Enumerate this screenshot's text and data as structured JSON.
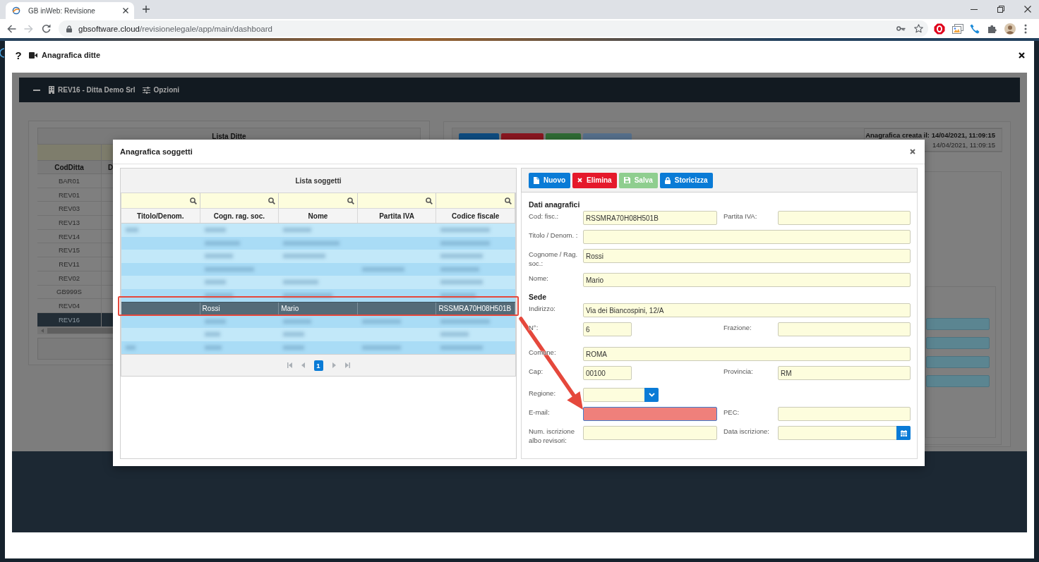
{
  "browser": {
    "tabs": [
      {
        "title": "GB inWeb: Revisione",
        "selected": true
      }
    ],
    "history": {
      "can_go_back": true,
      "can_go_forward": false
    },
    "address": {
      "host": "gbsoftware.cloud",
      "path": "/revisionelegale/app/main/dashboard"
    }
  },
  "window": {
    "help": "?",
    "title": "Anagrafica ditte"
  },
  "company_bar": {
    "title": "REV16 - Ditta Demo Srl",
    "options": "Opzioni"
  },
  "company_list": {
    "title": "Lista Ditte",
    "columns": [
      "CodDitta",
      "D"
    ],
    "rows": [
      {
        "code": "BAR01",
        "selected": false
      },
      {
        "code": "REV01",
        "selected": false
      },
      {
        "code": "REV03",
        "selected": false
      },
      {
        "code": "REV13",
        "selected": false
      },
      {
        "code": "REV14",
        "selected": false
      },
      {
        "code": "REV15",
        "selected": false
      },
      {
        "code": "REV11",
        "selected": false
      },
      {
        "code": "REV02",
        "selected": false
      },
      {
        "code": "GB999S",
        "selected": false
      },
      {
        "code": "REV04",
        "selected": false
      },
      {
        "code": "REV16",
        "selected": true
      }
    ]
  },
  "record_toolbar": {
    "buttons": [
      {
        "kind": "new",
        "disabled": false
      },
      {
        "kind": "delete",
        "disabled": false
      },
      {
        "kind": "save",
        "disabled": false
      },
      {
        "kind": "archive",
        "disabled": true
      }
    ],
    "created": "Anagrafica creata il: 14/04/2021, 11:09:15",
    "modified": "14/04/2021, 11:09:15"
  },
  "modal": {
    "title": "Anagrafica soggetti",
    "list": {
      "title": "Lista soggetti",
      "columns": [
        "Titolo/Denom.",
        "Cogn. rag. soc.",
        "Nome",
        "Partita IVA",
        "Codice fiscale"
      ],
      "rows": [
        {
          "selected": false,
          "blurred": true
        },
        {
          "selected": false,
          "blurred": true
        },
        {
          "selected": false,
          "blurred": true
        },
        {
          "selected": false,
          "blurred": true
        },
        {
          "selected": false,
          "blurred": true
        },
        {
          "selected": false,
          "blurred": true
        },
        {
          "selected": true,
          "blurred": false,
          "cells": [
            null,
            "Rossi",
            "Mario",
            null,
            "RSSMRA70H08H501B"
          ]
        },
        {
          "selected": false,
          "blurred": true
        },
        {
          "selected": false,
          "blurred": true
        },
        {
          "selected": false,
          "blurred": true
        }
      ],
      "pager": {
        "pages": [
          {
            "label": "1",
            "selected": true
          }
        ]
      }
    },
    "toolbar": [
      {
        "label": "Nuovo",
        "kind": "new",
        "disabled": false
      },
      {
        "label": "Elimina",
        "kind": "delete",
        "disabled": false
      },
      {
        "label": "Salva",
        "kind": "save",
        "disabled": true
      },
      {
        "label": "Storicizza",
        "kind": "archive",
        "disabled": false
      }
    ],
    "form": [
      {
        "title": "Dati anagrafici",
        "rows": [
          [
            {
              "label": "Cod: fisc.:",
              "kind": "text",
              "value": "RSSMRA70H08H501B",
              "invalid": false
            },
            {
              "label": "Partita IVA:",
              "kind": "text",
              "invalid": false
            }
          ],
          [
            {
              "label": "Titolo / Denom. :",
              "kind": "text",
              "invalid": false
            }
          ],
          [
            {
              "label": "Cognome / Rag. soc.:",
              "kind": "text",
              "value": "Rossi",
              "invalid": false
            }
          ],
          [
            {
              "label": "Nome:",
              "kind": "text",
              "value": "Mario",
              "invalid": false
            }
          ]
        ]
      },
      {
        "title": "Sede",
        "rows": [
          [
            {
              "label": "Indirizzo:",
              "kind": "text",
              "value": "Via dei Biancospini, 12/A",
              "invalid": false
            }
          ],
          [
            {
              "label": "N°:",
              "kind": "number",
              "value": "6",
              "invalid": false
            },
            {
              "label": "Frazione:",
              "kind": "text",
              "invalid": false
            }
          ],
          [
            {
              "label": "Comune:",
              "kind": "text",
              "value": "ROMA",
              "invalid": false
            }
          ],
          [
            {
              "label": "Cap:",
              "kind": "number",
              "value": "00100",
              "invalid": false
            },
            {
              "label": "Provincia:",
              "kind": "text",
              "value": "RM",
              "invalid": false
            }
          ],
          [
            {
              "label": "Regione:",
              "kind": "select",
              "invalid": false
            }
          ],
          [
            {
              "label": "E-mail:",
              "kind": "text",
              "invalid": true
            },
            {
              "label": "PEC:",
              "kind": "text",
              "invalid": false
            }
          ],
          [
            {
              "label": "Num. iscrizione albo revisori:",
              "kind": "text",
              "invalid": false
            },
            {
              "label": "Data iscrizione:",
              "kind": "date",
              "invalid": false
            }
          ]
        ]
      }
    ]
  },
  "annotations": {
    "highlight": true,
    "arrow": true
  }
}
